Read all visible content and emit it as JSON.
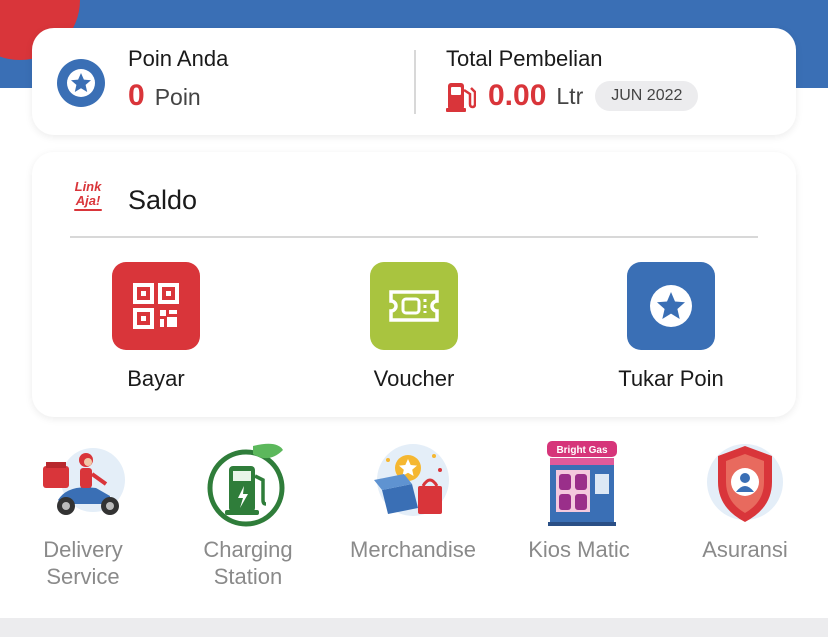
{
  "points": {
    "title": "Poin Anda",
    "value": "0",
    "unit": "Poin"
  },
  "purchase": {
    "title": "Total Pembelian",
    "value": "0.00",
    "unit": "Ltr",
    "month": "JUN 2022"
  },
  "wallet": {
    "logo_line1": "Link",
    "logo_line2": "Aja!",
    "label": "Saldo"
  },
  "actions": [
    {
      "label": "Bayar",
      "icon": "qr-code-icon",
      "color": "#d9353a"
    },
    {
      "label": "Voucher",
      "icon": "ticket-icon",
      "color": "#a9c43f"
    },
    {
      "label": "Tukar Poin",
      "icon": "star-icon",
      "color": "#3a6fb5"
    }
  ],
  "services": [
    {
      "line1": "Delivery",
      "line2": "Service",
      "icon": "delivery-scooter-icon"
    },
    {
      "line1": "Charging",
      "line2": "Station",
      "icon": "charging-station-icon"
    },
    {
      "line1": "Merchandise",
      "line2": "",
      "icon": "merchandise-gift-icon"
    },
    {
      "line1": "Kios Matic",
      "line2": "",
      "icon": "kiosk-icon",
      "sign": "Bright Gas"
    },
    {
      "line1": "Asuransi",
      "line2": "",
      "icon": "insurance-shield-icon"
    }
  ],
  "colors": {
    "header_blue": "#3a6fb5",
    "accent_red": "#d9353a",
    "voucher_green": "#a9c43f",
    "muted_text": "#8a8a8a"
  }
}
